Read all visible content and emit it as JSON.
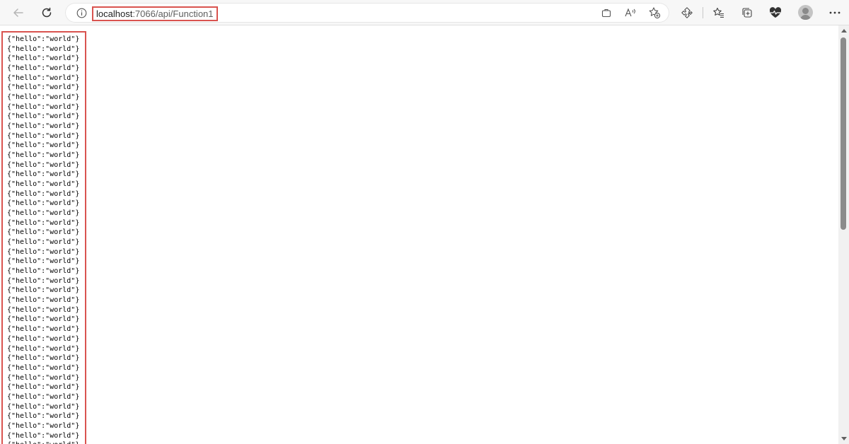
{
  "toolbar": {
    "back_icon": "back-arrow-icon",
    "refresh_icon": "refresh-icon",
    "info_icon": "info-icon",
    "address": {
      "host": "localhost",
      "rest": ":7066/api/Function1"
    },
    "right_icons": [
      "app-available-icon",
      "read-aloud-icon",
      "add-favorite-icon",
      "extensions-icon",
      "favorites-icon",
      "collections-icon",
      "browser-essentials-icon",
      "profile-avatar",
      "more-menu-icon"
    ]
  },
  "response": {
    "lines": [
      "{\"hello\":\"world\"}",
      "{\"hello\":\"world\"}",
      "{\"hello\":\"world\"}",
      "{\"hello\":\"world\"}",
      "{\"hello\":\"world\"}",
      "{\"hello\":\"world\"}",
      "{\"hello\":\"world\"}",
      "{\"hello\":\"world\"}",
      "{\"hello\":\"world\"}",
      "{\"hello\":\"world\"}",
      "{\"hello\":\"world\"}",
      "{\"hello\":\"world\"}",
      "{\"hello\":\"world\"}",
      "{\"hello\":\"world\"}",
      "{\"hello\":\"world\"}",
      "{\"hello\":\"world\"}",
      "{\"hello\":\"world\"}",
      "{\"hello\":\"world\"}",
      "{\"hello\":\"world\"}",
      "{\"hello\":\"world\"}",
      "{\"hello\":\"world\"}",
      "{\"hello\":\"world\"}",
      "{\"hello\":\"world\"}",
      "{\"hello\":\"world\"}",
      "{\"hello\":\"world\"}",
      "{\"hello\":\"world\"}",
      "{\"hello\":\"world\"}",
      "{\"hello\":\"world\"}",
      "{\"hello\":\"world\"}",
      "{\"hello\":\"world\"}",
      "{\"hello\":\"world\"}",
      "{\"hello\":\"world\"}",
      "{\"hello\":\"world\"}",
      "{\"hello\":\"world\"}",
      "{\"hello\":\"world\"}",
      "{\"hello\":\"world\"}",
      "{\"hello\":\"world\"}",
      "{\"hello\":\"world\"}",
      "{\"hello\":\"world\"}",
      "{\"hello\":\"world\"}",
      "{\"hello\":\"world\"}",
      "{\"hello\":\"world\"}",
      "{\"hello\":\"world\"}"
    ]
  },
  "colors": {
    "highlight": "#d9534f",
    "toolbar_bg": "#f7f7f7",
    "scroll_thumb": "#8b8b8b"
  }
}
